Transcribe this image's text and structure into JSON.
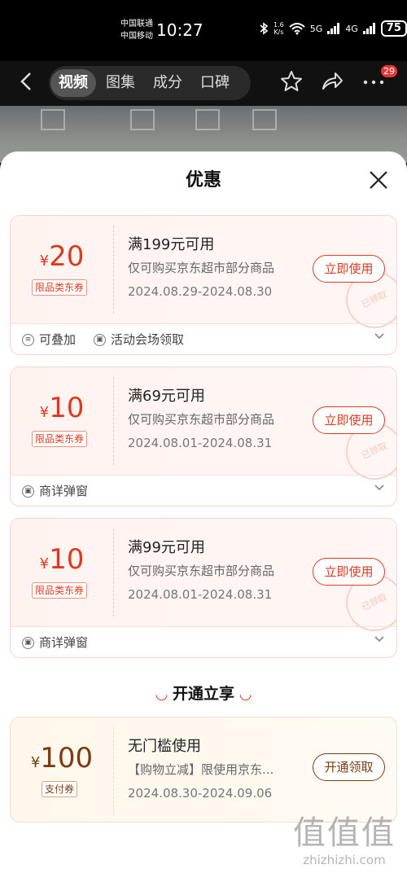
{
  "status_bar": {
    "carrier_1": "中国联通",
    "carrier_2": "中国移动",
    "time": "10:27",
    "speed_value": "1.6",
    "speed_unit": "K/s",
    "net_1": "5G",
    "net_2": "4G",
    "battery": "75"
  },
  "nav": {
    "tabs": [
      {
        "label": "视频",
        "active": true
      },
      {
        "label": "图集",
        "active": false
      },
      {
        "label": "成分",
        "active": false
      },
      {
        "label": "口碑",
        "active": false
      }
    ],
    "badge": "29"
  },
  "sheet": {
    "title": "优惠"
  },
  "coupons": [
    {
      "currency": "¥",
      "amount": "20",
      "tag": "限品类东券",
      "condition": "满199元可用",
      "description": "仅可购买京东超市部分商品",
      "date_range": "2024.08.29-2024.08.30",
      "button": "立即使用",
      "stamp": "已领取",
      "footer": [
        {
          "icon": "stack-icon",
          "text": "可叠加"
        },
        {
          "icon": "ticket-icon",
          "text": "活动会场领取"
        }
      ]
    },
    {
      "currency": "¥",
      "amount": "10",
      "tag": "限品类东券",
      "condition": "满69元可用",
      "description": "仅可购买京东超市部分商品",
      "date_range": "2024.08.01-2024.08.31",
      "button": "立即使用",
      "stamp": "已领取",
      "footer": [
        {
          "icon": "ticket-icon",
          "text": "商详弹窗"
        }
      ]
    },
    {
      "currency": "¥",
      "amount": "10",
      "tag": "限品类东券",
      "condition": "满99元可用",
      "description": "仅可购买京东超市部分商品",
      "date_range": "2024.08.01-2024.08.31",
      "button": "立即使用",
      "stamp": "已领取",
      "footer": [
        {
          "icon": "ticket-icon",
          "text": "商详弹窗"
        }
      ]
    }
  ],
  "section": {
    "title": "开通立享"
  },
  "pay_coupon": {
    "currency": "¥",
    "amount": "100",
    "tag": "支付券",
    "condition": "无门槛使用",
    "description": "【购物立减】限使用京东...",
    "date_range": "2024.08.30-2024.09.06",
    "button": "开通领取"
  },
  "watermark": {
    "logo": "值值值",
    "url": "zhizhizhi.com"
  },
  "colors": {
    "accent": "#e03a1e",
    "pay_accent": "#7a3d12"
  }
}
